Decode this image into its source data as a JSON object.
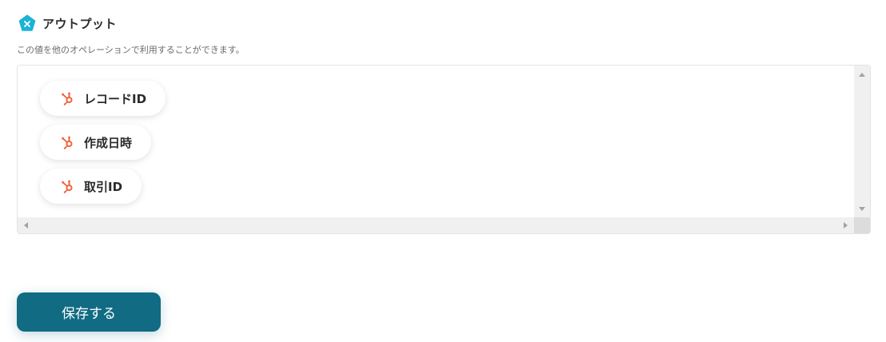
{
  "section": {
    "title": "アウトプット",
    "description": "この値を他のオペレーションで利用することができます。",
    "icon": "pentagon-x-icon",
    "icon_color": "#1ab3d6"
  },
  "outputs": [
    {
      "label": "レコードID",
      "icon": "hubspot-icon"
    },
    {
      "label": "作成日時",
      "icon": "hubspot-icon"
    },
    {
      "label": "取引ID",
      "icon": "hubspot-icon"
    }
  ],
  "hubspot_color": "#f0643c",
  "save_button": {
    "label": "保存する",
    "color": "#106b83"
  }
}
